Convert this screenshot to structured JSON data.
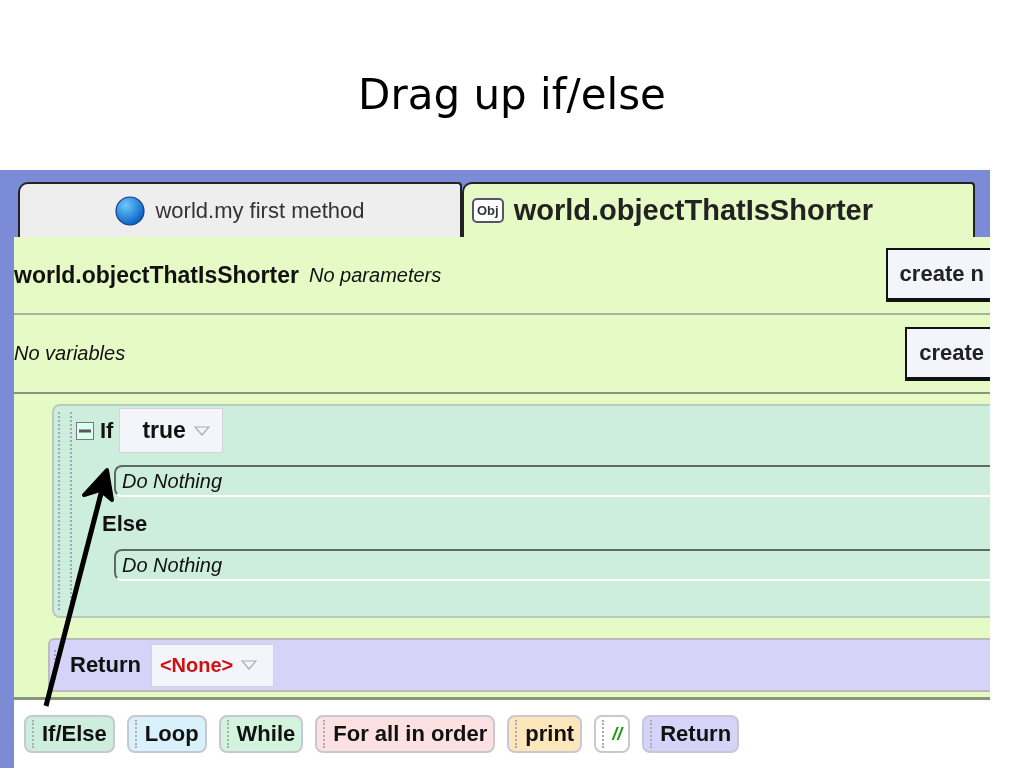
{
  "slide": {
    "title": "Drag up if/else"
  },
  "tabs": [
    {
      "kind": "world",
      "label": "world.my first method",
      "selected": false
    },
    {
      "kind": "object",
      "badge": "Obj",
      "label": "world.objectThatIsShorter",
      "selected": true
    }
  ],
  "method": {
    "name": "world.objectThatIsShorter",
    "parameters": "No parameters",
    "variables": "No variables",
    "parameter_button": "create n",
    "variable_button": "create"
  },
  "code": {
    "if_block": {
      "keyword": "If",
      "condition": "true",
      "expanded": true,
      "then": "Do Nothing",
      "else_label": "Else",
      "else": "Do Nothing"
    },
    "return_block": {
      "keyword": "Return",
      "value": "<None>"
    }
  },
  "palette": [
    {
      "kind": "statement",
      "label": "If/Else",
      "color": "#cdeedd"
    },
    {
      "kind": "statement",
      "label": "Loop",
      "color": "#d9f1fb"
    },
    {
      "kind": "statement",
      "label": "While",
      "color": "#d3f4dc"
    },
    {
      "kind": "statement",
      "label": "For all in order",
      "color": "#fbe1e1"
    },
    {
      "kind": "statement",
      "label": "print",
      "color": "#fde6b9"
    },
    {
      "kind": "comment",
      "label": "//",
      "color": "#ffffff"
    },
    {
      "kind": "statement",
      "label": "Return",
      "color": "#d7d3f8"
    }
  ]
}
